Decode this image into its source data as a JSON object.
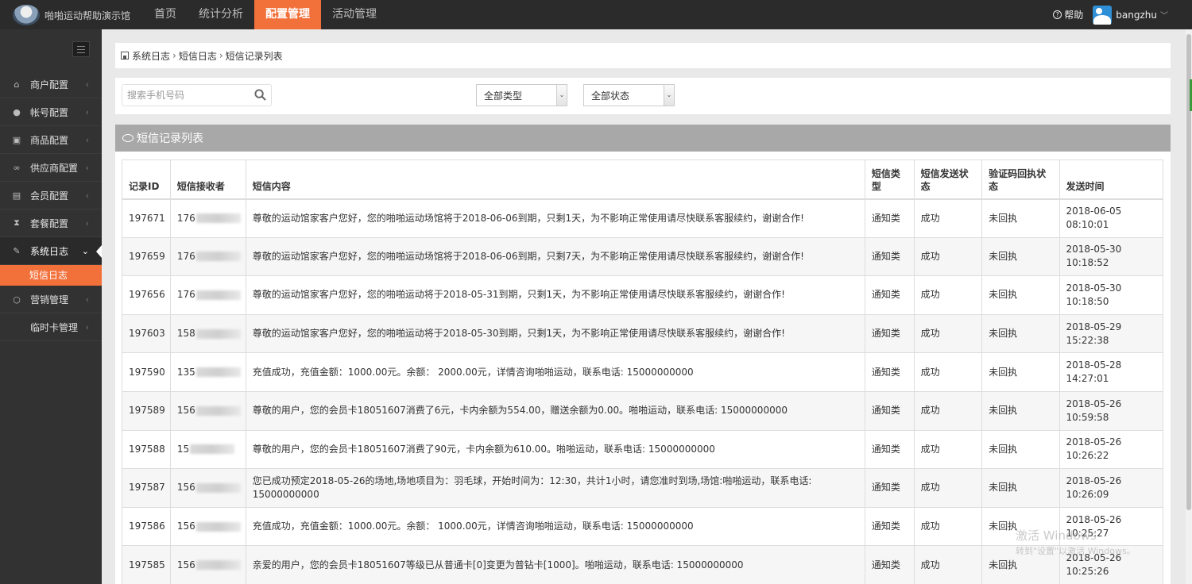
{
  "app": {
    "title": "啪啪运动帮助演示馆",
    "help": "帮助",
    "username": "bangzhu"
  },
  "nav": [
    "首页",
    "统计分析",
    "配置管理",
    "活动管理"
  ],
  "sidebar": {
    "items": [
      {
        "label": "商户配置",
        "icon": "home-icon",
        "glyph": "⌂"
      },
      {
        "label": "帐号配置",
        "icon": "user-icon",
        "glyph": "●"
      },
      {
        "label": "商品配置",
        "icon": "gift-icon",
        "glyph": "▣"
      },
      {
        "label": "供应商配置",
        "icon": "link-icon",
        "glyph": "∞"
      },
      {
        "label": "会员配置",
        "icon": "id-card-icon",
        "glyph": "▤"
      },
      {
        "label": "套餐配置",
        "icon": "hourglass-icon",
        "glyph": "⧗"
      },
      {
        "label": "系统日志",
        "icon": "edit-icon",
        "glyph": "✎"
      },
      {
        "label": "营销管理",
        "icon": "circle-icon",
        "glyph": "○"
      },
      {
        "label": "临时卡管理",
        "icon": "",
        "glyph": ""
      }
    ],
    "sub_item": "短信日志"
  },
  "breadcrumb": [
    "系统日志",
    "短信日志",
    "短信记录列表"
  ],
  "filters": {
    "search_placeholder": "搜索手机号码",
    "type_select": "全部类型",
    "status_select": "全部状态"
  },
  "panel": {
    "title": "短信记录列表"
  },
  "table": {
    "headers": [
      "记录ID",
      "短信接收者",
      "短信内容",
      "短信类型",
      "短信发送状态",
      "验证码回执状态",
      "发送时间"
    ],
    "rows": [
      {
        "id": "197671",
        "receiver": "176",
        "content": "尊敬的运动馆家客户您好，您的啪啪运动场馆将于2018-06-06到期，只剩1天，为不影响正常使用请尽快联系客服续约，谢谢合作!",
        "type": "通知类",
        "state": "成功",
        "ack": "未回执",
        "date": "2018-06-05",
        "time": "08:10:01"
      },
      {
        "id": "197659",
        "receiver": "176",
        "content": "尊敬的运动馆家客户您好，您的啪啪运动场馆将于2018-06-06到期，只剩7天，为不影响正常使用请尽快联系客服续约，谢谢合作!",
        "type": "通知类",
        "state": "成功",
        "ack": "未回执",
        "date": "2018-05-30",
        "time": "10:18:52"
      },
      {
        "id": "197656",
        "receiver": "176",
        "content": "尊敬的运动馆家客户您好，您的啪啪运动将于2018-05-31到期，只剩1天，为不影响正常使用请尽快联系客服续约，谢谢合作!",
        "type": "通知类",
        "state": "成功",
        "ack": "未回执",
        "date": "2018-05-30",
        "time": "10:18:50"
      },
      {
        "id": "197603",
        "receiver": "158",
        "content": "尊敬的运动馆家客户您好，您的啪啪运动将于2018-05-30到期，只剩1天，为不影响正常使用请尽快联系客服续约，谢谢合作!",
        "type": "通知类",
        "state": "成功",
        "ack": "未回执",
        "date": "2018-05-29",
        "time": "15:22:38"
      },
      {
        "id": "197590",
        "receiver": "135",
        "content": "充值成功，充值金额：1000.00元。余额： 2000.00元，详情咨询啪啪运动，联系电话: 15000000000",
        "type": "通知类",
        "state": "成功",
        "ack": "未回执",
        "date": "2018-05-28",
        "time": "14:27:01"
      },
      {
        "id": "197589",
        "receiver": "156",
        "content": "尊敬的用户，您的会员卡18051607消费了6元，卡内余额为554.00，赠送余额为0.00。啪啪运动，联系电话: 15000000000",
        "type": "通知类",
        "state": "成功",
        "ack": "未回执",
        "date": "2018-05-26",
        "time": "10:59:58"
      },
      {
        "id": "197588",
        "receiver": "15",
        "content": "尊敬的用户，您的会员卡18051607消费了90元，卡内余额为610.00。啪啪运动，联系电话: 15000000000",
        "type": "通知类",
        "state": "成功",
        "ack": "未回执",
        "date": "2018-05-26",
        "time": "10:26:22"
      },
      {
        "id": "197587",
        "receiver": "156",
        "content": "您已成功预定2018-05-26的场地,场地项目为：羽毛球，开始时间为：12:30，共计1小时，请您准时到场,场馆:啪啪运动，联系电话: 15000000000",
        "type": "通知类",
        "state": "成功",
        "ack": "未回执",
        "date": "2018-05-26",
        "time": "10:26:09"
      },
      {
        "id": "197586",
        "receiver": "156",
        "content": "充值成功，充值金额：1000.00元。余额： 1000.00元，详情咨询啪啪运动，联系电话: 15000000000",
        "type": "通知类",
        "state": "成功",
        "ack": "未回执",
        "date": "2018-05-26",
        "time": "10:25:27"
      },
      {
        "id": "197585",
        "receiver": "156",
        "content": "亲爱的用户，您的会员卡18051607等级已从普通卡[0]变更为普钻卡[1000]。啪啪运动，联系电话: 15000000000",
        "type": "通知类",
        "state": "成功",
        "ack": "未回执",
        "date": "2018-05-26",
        "time": "10:25:26"
      }
    ]
  },
  "watermark": {
    "line1": "激活 Windows",
    "line2": "转到\"设置\"以激活 Windows。"
  },
  "colors": {
    "accent": "#f2703a",
    "topbar": "#2b2b2b",
    "sidebar": "#323232",
    "panel_head": "#a8a8a8"
  }
}
